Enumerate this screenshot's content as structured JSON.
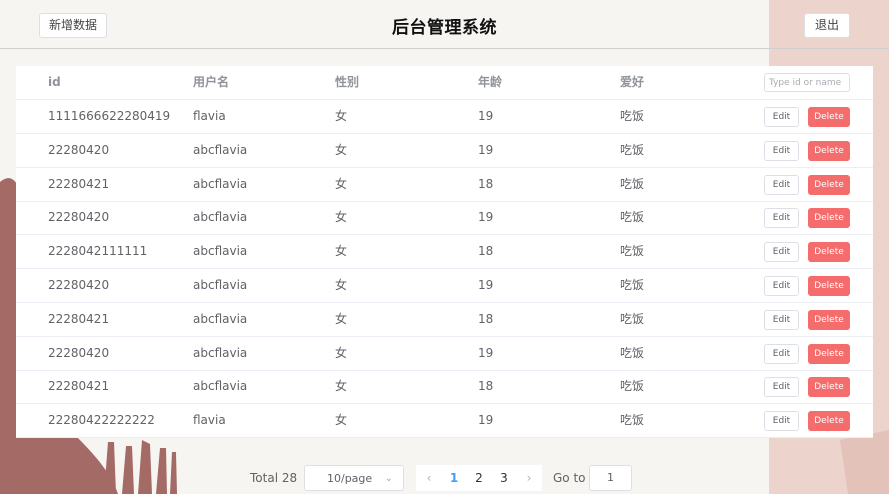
{
  "header": {
    "title": "后台管理系统",
    "add_label": "新增数据",
    "logout_label": "退出"
  },
  "table": {
    "columns": [
      "id",
      "用户名",
      "性别",
      "年龄",
      "爱好"
    ],
    "search_placeholder": "Type id or name",
    "rows": [
      {
        "id": "1111666622280419",
        "name": "flavia",
        "gender": "女",
        "age": "19",
        "hobby": "吃饭"
      },
      {
        "id": "22280420",
        "name": "abcflavia",
        "gender": "女",
        "age": "19",
        "hobby": "吃饭"
      },
      {
        "id": "22280421",
        "name": "abcflavia",
        "gender": "女",
        "age": "18",
        "hobby": "吃饭"
      },
      {
        "id": "22280420",
        "name": "abcflavia",
        "gender": "女",
        "age": "19",
        "hobby": "吃饭"
      },
      {
        "id": "2228042111111",
        "name": "abcflavia",
        "gender": "女",
        "age": "18",
        "hobby": "吃饭"
      },
      {
        "id": "22280420",
        "name": "abcflavia",
        "gender": "女",
        "age": "19",
        "hobby": "吃饭"
      },
      {
        "id": "22280421",
        "name": "abcflavia",
        "gender": "女",
        "age": "18",
        "hobby": "吃饭"
      },
      {
        "id": "22280420",
        "name": "abcflavia",
        "gender": "女",
        "age": "19",
        "hobby": "吃饭"
      },
      {
        "id": "22280421",
        "name": "abcflavia",
        "gender": "女",
        "age": "18",
        "hobby": "吃饭"
      },
      {
        "id": "22280422222222",
        "name": "flavia",
        "gender": "女",
        "age": "19",
        "hobby": "吃饭"
      }
    ],
    "edit_label": "Edit",
    "delete_label": "Delete"
  },
  "pagination": {
    "total_label": "Total 28",
    "page_size": "10/page",
    "pages": [
      "1",
      "2",
      "3"
    ],
    "current_page": "1",
    "goto_label": "Go to",
    "goto_value": "1",
    "prev_icon": "chevron-left-icon",
    "next_icon": "chevron-right-icon"
  },
  "colors": {
    "background": "#f7f5f1",
    "brush_dark": "#a36a66",
    "brush_light": "#ecd3cc",
    "delete_button": "#f56c6c",
    "active_page": "#409eff"
  }
}
